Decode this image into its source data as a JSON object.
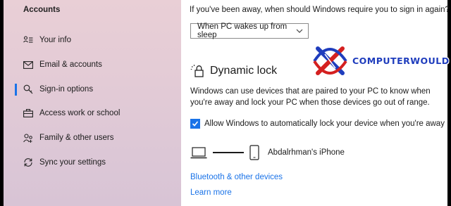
{
  "sidebar": {
    "title": "Accounts",
    "items": [
      {
        "label": "Your info",
        "icon": "person-card-icon",
        "active": false
      },
      {
        "label": "Email & accounts",
        "icon": "mail-icon",
        "active": false
      },
      {
        "label": "Sign-in options",
        "icon": "key-icon",
        "active": true
      },
      {
        "label": "Access work or school",
        "icon": "briefcase-icon",
        "active": false
      },
      {
        "label": "Family & other users",
        "icon": "people-icon",
        "active": false
      },
      {
        "label": "Sync your settings",
        "icon": "sync-icon",
        "active": false
      }
    ]
  },
  "main": {
    "question": "If you've been away, when should Windows require you to sign in again?",
    "dropdown_value": "When PC wakes up from sleep",
    "dynamic_lock": {
      "title": "Dynamic lock",
      "description": "Windows can use devices that are paired to your PC to know when you're away and lock your PC when those devices go out of range.",
      "checkbox_label": "Allow Windows to automatically lock your device when you're away",
      "checkbox_checked": true,
      "device_name": "Abdalrhman's iPhone"
    },
    "links": {
      "bluetooth": "Bluetooth & other devices",
      "learn_more": "Learn more"
    }
  },
  "watermark": {
    "text": "COMPUTERWOULD"
  },
  "colors": {
    "accent": "#1a73e8",
    "sidebar_bg": "#e5cbd5",
    "frame": "#000000"
  }
}
